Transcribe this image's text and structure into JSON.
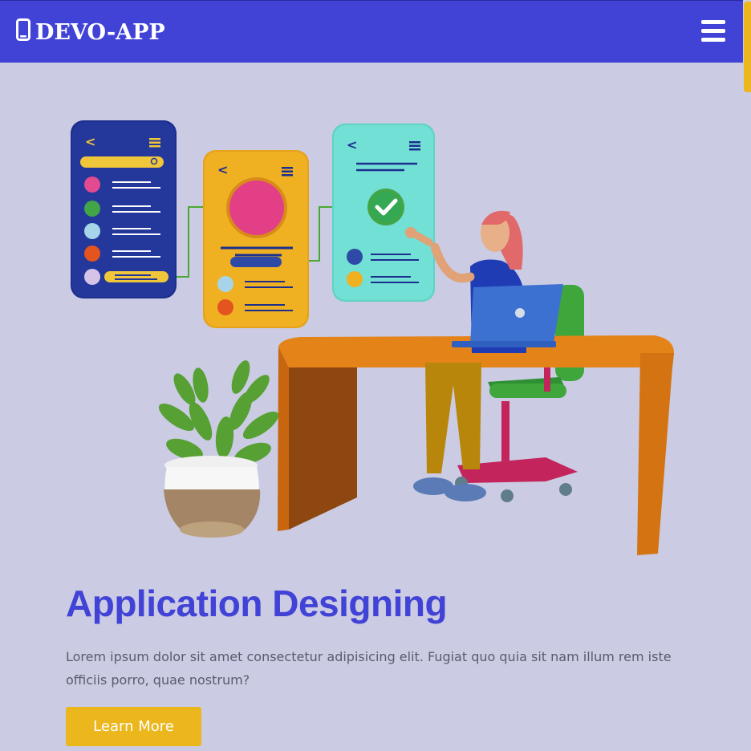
{
  "navbar": {
    "brand": "DEVO-APP",
    "brand_icon": "mobile-phone-icon",
    "menu_icon": "hamburger-menu-icon",
    "background": "#4142d6"
  },
  "hero": {
    "title": "Application Designing",
    "description": "Lorem ipsum dolor sit amet consectetur adipisicing elit. Fugiat quo quia sit nam illum rem iste officiis porro, quae nostrum?",
    "button_label": "Learn More"
  },
  "colors": {
    "accent": "#4142d6",
    "button": "#ebb71c",
    "page_background": "#cbcbe3"
  }
}
